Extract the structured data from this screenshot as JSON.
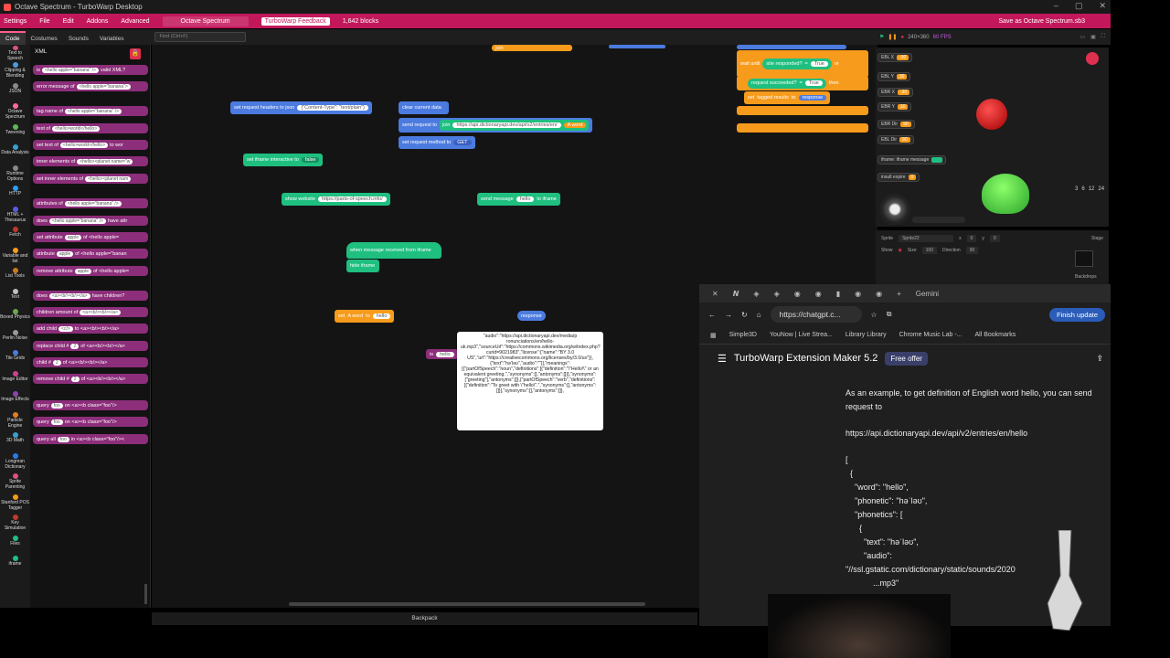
{
  "window": {
    "title": "Octave Spectrum - TurboWarp Desktop"
  },
  "menu": {
    "items": [
      "Settings",
      "File",
      "Edit",
      "Addons",
      "Advanced"
    ],
    "project_title": "Octave Spectrum",
    "feedback": "TurboWarp Feedback",
    "block_count": "1,642 blocks",
    "save": "Save as Octave Spectrum.sb3"
  },
  "editor_tabs": [
    "Code",
    "Costumes",
    "Sounds",
    "Variables"
  ],
  "find_placeholder": "Find (Ctrl+F)",
  "categories": [
    "Text to Speech",
    "Clipping & Blending",
    "JSON",
    "Octave Spectrum",
    "Tweening",
    "Data Analysis",
    "Runtime Options",
    "HTTP",
    "HTML + Thesaurus",
    "Fetch",
    "Variable and list",
    "List Tools",
    "Text",
    "Boxed Physics",
    "Perlin Noise",
    "Tile Grids",
    "Image Editor",
    "Image Effects",
    "Particle Engine",
    "3D Math",
    "Longman Dictionary",
    "Sprite Parenting",
    "Stanford POS Tagger",
    "Key Simulation",
    "Files",
    "iframe"
  ],
  "flyout": {
    "section": "XML",
    "blocks": [
      {
        "pre": "is",
        "input": "<hello apple=\"banana\" />",
        "post": "valid XML?"
      },
      {
        "pre": "error message of",
        "input": "<hello apple=\"banana\">",
        "post": ""
      },
      {
        "pre": "tag name of",
        "input": "<hello apple=\"banana\" />",
        "post": ""
      },
      {
        "pre": "text of",
        "input": "<hello>world</hello>",
        "post": ""
      },
      {
        "pre": "set text of",
        "input": "<hello>world</hello>",
        "post": "to wor"
      },
      {
        "pre": "inner elements of",
        "input": "<hello><planet name=\"w",
        "post": ""
      },
      {
        "pre": "set inner elements of",
        "input": "<hello><planet nam",
        "post": ""
      },
      {
        "pre": "attributes of",
        "input": "<hello apple=\"banana\" />",
        "post": ""
      },
      {
        "pre": "does",
        "input": "<hello apple=\"banana\" />",
        "post": "have attr"
      },
      {
        "pre": "set attribute",
        "input": "apple",
        "post": "of <hello apple="
      },
      {
        "pre": "attribute",
        "input": "apple",
        "post": "of <hello apple=\"banan"
      },
      {
        "pre": "remove attribute",
        "input": "apple",
        "post": "of <hello apple="
      },
      {
        "pre": "does",
        "input": "<a><b/><b/></a>",
        "post": "have children?"
      },
      {
        "pre": "children amount of",
        "input": "<a><b/><b/></a>",
        "post": ""
      },
      {
        "pre": "add child",
        "input": "<c/>",
        "post": "to <a><b/><b/></a>"
      },
      {
        "pre": "replace child #",
        "input": "2",
        "post": "of <a><b/><b/></a>"
      },
      {
        "pre": "child #",
        "input": "2",
        "post": "of <a><b/><b/></a>"
      },
      {
        "pre": "remove child #",
        "input": "2",
        "post": "of <a><b/><b/></a>"
      },
      {
        "pre": "query",
        "input": "foo",
        "post": "on <a><b class=\"foo\"/>"
      },
      {
        "pre": "query",
        "input": "foo",
        "post": "on <a><b class=\"foo\"/>"
      },
      {
        "pre": "query all",
        "input": "foo",
        "post": "in <a><b class=\"foo\"/><"
      }
    ]
  },
  "workspace": {
    "set_headers": {
      "label": "set request headers to json",
      "value": "{\"Content-Type\": \"text/plain\"}"
    },
    "clear_data": "clear current data",
    "send_request": {
      "label": "send request to",
      "json": "join",
      "url": "https://api.dictionaryapi.dev/api/v2/entries/en/",
      "word": "A word"
    },
    "set_method": {
      "label": "set request method to",
      "value": "GET"
    },
    "iframe_interactive": {
      "label": "set iframe interactive to",
      "value": "false"
    },
    "show_website": {
      "label": "show website",
      "value": "https://parts-of-speech.info/"
    },
    "send_message": {
      "label": "send message",
      "value": "hello",
      "post": "to iframe"
    },
    "when_message": "when message received from iframe",
    "hide_iframe": "hide iframe",
    "set_word": {
      "pre": "set",
      "var": "A word",
      "mid": "to",
      "value": "hello"
    },
    "response": "response",
    "is_label": "is",
    "is_value": "hello",
    "response_bubble": "\"audio\":\"https://api.dictionaryapi.dev/media/p ronunciations/en/hello-uk.mp3\",\"sourceUrl\":\"https://commons.wikimedia.org/w/index.php?curid=9021983\",\"license\":{\"name\":\"BY 3.0 US\",\"url\":\"https://creativecommons.org/licenses/by/3.0/us\"}},{\"text\":\"hə'ləʊ\",\"audio\":\"\"}],\"meanings\":[{\"partOfSpeech\":\"noun\",\"definitions\":[{\"definition\":\"\\\"Hello!\\\" or an equivalent greeting.\",\"synonyms\":[],\"antonyms\":[]}],\"synonyms\":[\"greeting\"],\"antonyms\":[]},{\"partOfSpeech\":\"verb\",\"definitions\":[{\"definition\":\"To greet with \\\"hello\\\".\",\"synonyms\":[],\"antonyms\":[]}],\"synonyms\":[],\"antonyms\":[]},",
    "wait_until": "wait until",
    "site_responded": "site responded?",
    "equals": "=",
    "true_label": "True",
    "or_label": "or",
    "request_succeeded": "request succeeded?",
    "then": "then",
    "set_tagged": {
      "pre": "set",
      "var": "tagged results",
      "mid": "to",
      "value": "response"
    },
    "top_block": "join"
  },
  "stage": {
    "fps": "60 FPS",
    "resolution": "240×360",
    "monitors": [
      {
        "label": "EBL X",
        "value": "-30"
      },
      {
        "label": "EBL Y",
        "value": "30"
      },
      {
        "label": "EBR X",
        "value": "-30"
      },
      {
        "label": "EBR Y",
        "value": "30"
      },
      {
        "label": "EBR Dir",
        "value": "90"
      },
      {
        "label": "EBL Dir",
        "value": "90"
      },
      {
        "label": "iframe: iframe message",
        "value": ""
      },
      {
        "label": "insult expire",
        "value": "0"
      }
    ],
    "numbers": [
      "3",
      "6",
      "12",
      "24"
    ]
  },
  "sprite": {
    "sprite_label": "Sprite",
    "name": "Sprite22",
    "x_label": "x",
    "x": "0",
    "y_label": "y",
    "y": "0",
    "show_label": "Show",
    "size_label": "Size",
    "size": "100",
    "direction_label": "Direction",
    "direction": "90",
    "stage_label": "Stage",
    "backdrops_label": "Backdrops"
  },
  "browser": {
    "url": "https://chatgpt.c...",
    "finish_update": "Finish update",
    "gemini": "Gemini",
    "bookmarks": [
      "Simple3D",
      "YouNow | Live Strea...",
      "Library Library",
      "Chrome Music Lab -...",
      "All Bookmarks"
    ],
    "gpt_title": "TurboWarp Extension Maker 5.2",
    "free_offer": "Free offer",
    "message": "As an example, to get definition of English word hello, you can send request to",
    "link": "https://api.dictionaryapi.dev/api/v2/entries/en/hello",
    "code": "[\n  {\n    \"word\": \"hello\",\n    \"phonetic\": \"həˈləʊ\",\n    \"phonetics\": [\n      {\n        \"text\": \"həˈləʊ\",\n        \"audio\":\n\"//ssl.gstatic.com/dictionary/static/sounds/2020\n            ...mp3\""
  },
  "backpack": "Backpack",
  "colors": {
    "accent": "#c2185b",
    "looks_blue": "#4c7be0",
    "extension_green": "#1fbf80",
    "variables_orange": "#f79b1c",
    "xml_purple": "#8c2e7a"
  }
}
